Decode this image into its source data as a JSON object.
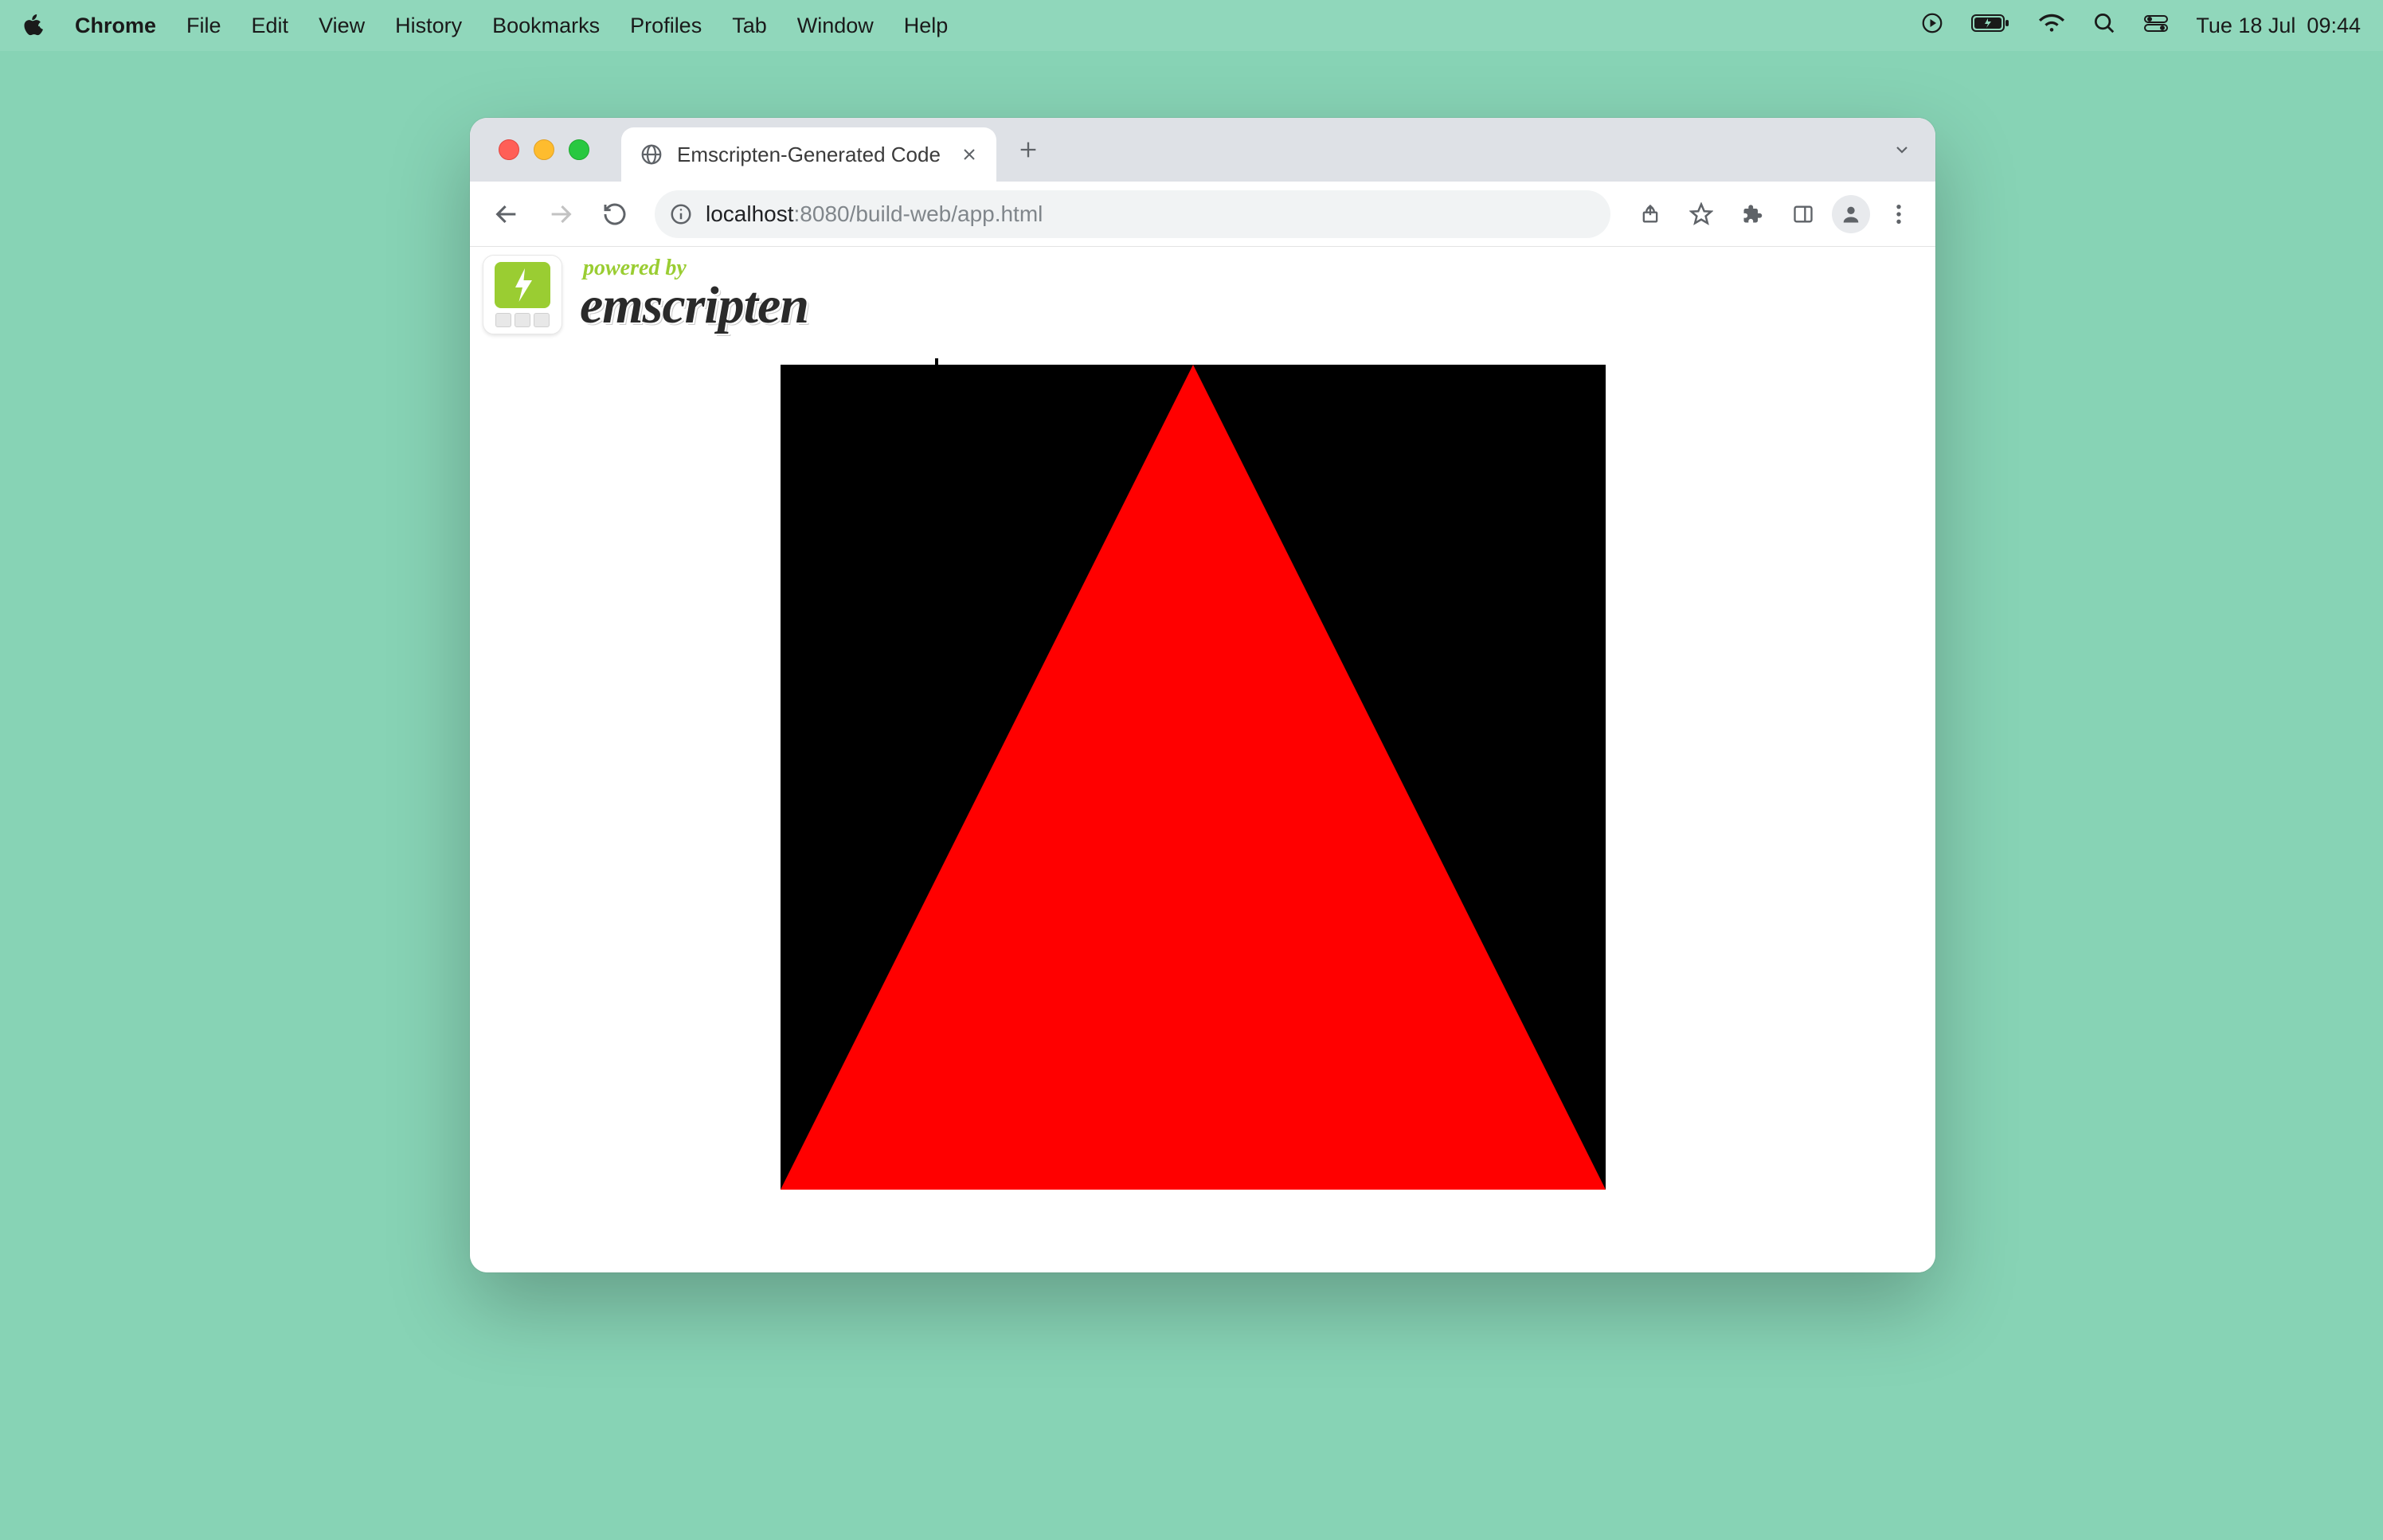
{
  "menubar": {
    "app_name": "Chrome",
    "items": [
      "File",
      "Edit",
      "View",
      "History",
      "Bookmarks",
      "Profiles",
      "Tab",
      "Window",
      "Help"
    ],
    "clock_day": "Tue 18 Jul",
    "clock_time": "09:44"
  },
  "browser": {
    "tab_title": "Emscripten-Generated Code",
    "url_host": "localhost",
    "url_port_path": ":8080/build-web/app.html"
  },
  "page": {
    "powered_by": "powered by",
    "brand": "emscripten",
    "canvas": {
      "bg_color": "#000000",
      "triangle_color": "#ff0000"
    }
  }
}
